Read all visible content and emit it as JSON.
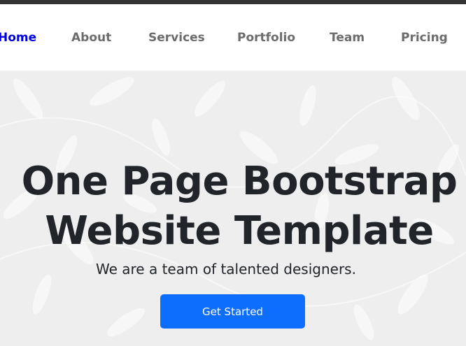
{
  "nav": {
    "items": [
      {
        "label": "Home",
        "active": true
      },
      {
        "label": "About"
      },
      {
        "label": "Services"
      },
      {
        "label": "Portfolio"
      },
      {
        "label": "Team"
      },
      {
        "label": "Pricing"
      }
    ]
  },
  "hero": {
    "title_line1": "One Page Bootstrap",
    "title_line2": "Website Template",
    "subtitle": "We are a team of talented designers.",
    "cta_label": "Get Started"
  },
  "colors": {
    "accent": "#0d6efd",
    "active_nav": "#0000dd",
    "nav_text": "#6c6c6c",
    "heading": "#212529",
    "hero_bg": "#eeeeef",
    "topbar": "#333333"
  }
}
